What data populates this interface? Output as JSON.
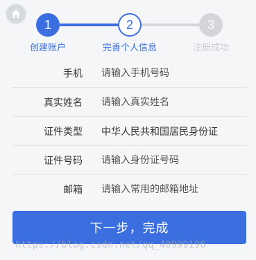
{
  "stepper": {
    "steps": [
      {
        "number": "1",
        "label": "创建账户",
        "state": "done"
      },
      {
        "number": "2",
        "label": "完善个人信息",
        "state": "current"
      },
      {
        "number": "3",
        "label": "注册成功",
        "state": "pending"
      }
    ]
  },
  "form": {
    "phone": {
      "label": "手机",
      "placeholder": "请输入手机号码"
    },
    "name": {
      "label": "真实姓名",
      "placeholder": "请输入真实姓名"
    },
    "id_type": {
      "label": "证件类型",
      "value": "中华人民共和国居民身份证"
    },
    "id_number": {
      "label": "证件号码",
      "placeholder": "请输入身份证号码"
    },
    "email": {
      "label": "邮箱",
      "placeholder": "请输入常用的邮箱地址"
    }
  },
  "submit_label": "下一步，完成",
  "watermark": "https://blog.csdn.net/qq_40999196",
  "colors": {
    "accent": "#3b6fe0",
    "inactive": "#d3d5d9",
    "background": "#f5f6f8"
  }
}
